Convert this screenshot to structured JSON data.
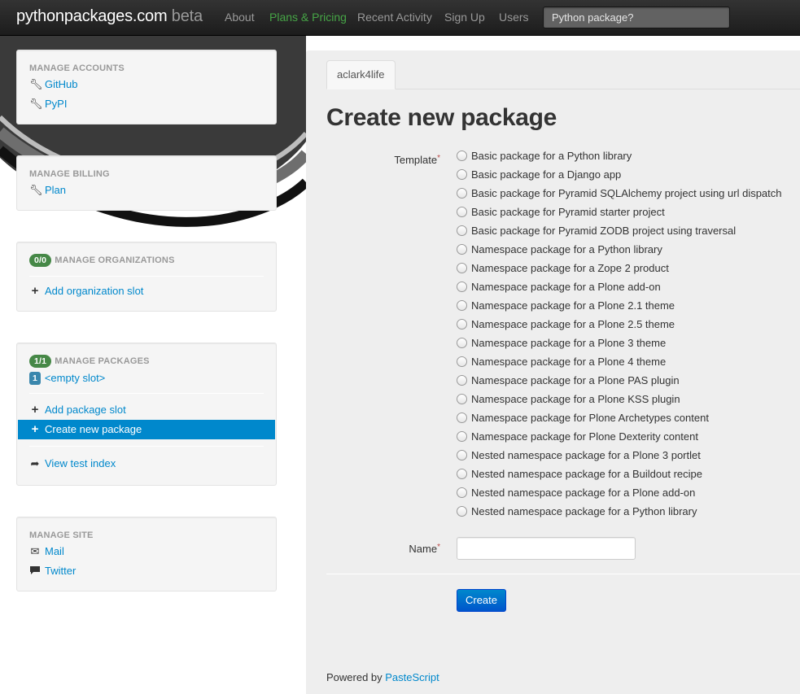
{
  "brand": {
    "name": "pythonpackages.com",
    "beta": "beta"
  },
  "nav": [
    {
      "label": "About",
      "active": false
    },
    {
      "label": "Plans & Pricing",
      "active": true
    },
    {
      "label": "Recent Activity",
      "active": false
    },
    {
      "label": "Sign Up",
      "active": false
    },
    {
      "label": "Users",
      "active": false
    }
  ],
  "search": {
    "placeholder": "Python package?"
  },
  "sidebar": {
    "accounts": {
      "header": "Manage Accounts",
      "items": [
        {
          "label": "GitHub",
          "icon": "wrench-icon"
        },
        {
          "label": "PyPI",
          "icon": "wrench-icon"
        }
      ]
    },
    "billing": {
      "header": "Manage Billing",
      "items": [
        {
          "label": "Plan",
          "icon": "wrench-icon"
        }
      ]
    },
    "organizations": {
      "badge": "0/0",
      "header": "Manage Organizations",
      "items": [
        {
          "label": "Add organization slot",
          "icon": "plus-icon"
        }
      ]
    },
    "packages": {
      "badge": "1/1",
      "header": "Manage Packages",
      "slot": {
        "number": "1",
        "label": "<empty slot>"
      },
      "items": [
        {
          "label": "Add package slot",
          "icon": "plus-icon"
        },
        {
          "label": "Create new package",
          "icon": "plus-icon",
          "active": true
        }
      ],
      "extra": {
        "label": "View test index",
        "icon": "share-arrow-icon"
      }
    },
    "site": {
      "header": "Manage Site",
      "items": [
        {
          "label": "Mail",
          "icon": "envelope-icon"
        },
        {
          "label": "Twitter",
          "icon": "comment-icon"
        }
      ]
    }
  },
  "main": {
    "tab": "aclark4life",
    "title": "Create new package",
    "template_label": "Template",
    "required_mark": "*",
    "templates": [
      "Basic package for a Python library",
      "Basic package for a Django app",
      "Basic package for Pyramid SQLAlchemy project using url dispatch",
      "Basic package for Pyramid starter project",
      "Basic package for Pyramid ZODB project using traversal",
      "Namespace package for a Python library",
      "Namespace package for a Zope 2 product",
      "Namespace package for a Plone add-on",
      "Namespace package for a Plone 2.1 theme",
      "Namespace package for a Plone 2.5 theme",
      "Namespace package for a Plone 3 theme",
      "Namespace package for a Plone 4 theme",
      "Namespace package for a Plone PAS plugin",
      "Namespace package for a Plone KSS plugin",
      "Namespace package for Plone Archetypes content",
      "Namespace package for Plone Dexterity content",
      "Nested namespace package for a Plone 3 portlet",
      "Nested namespace package for a Buildout recipe",
      "Nested namespace package for a Plone add-on",
      "Nested namespace package for a Python library"
    ],
    "name_label": "Name",
    "name_value": "",
    "create_label": "Create",
    "footer_text": "Powered by ",
    "footer_link": "PasteScript"
  },
  "colors": {
    "link": "#0088cc",
    "active_nav": "#46a546",
    "badge": "#468847",
    "primary": "#0088cc"
  }
}
